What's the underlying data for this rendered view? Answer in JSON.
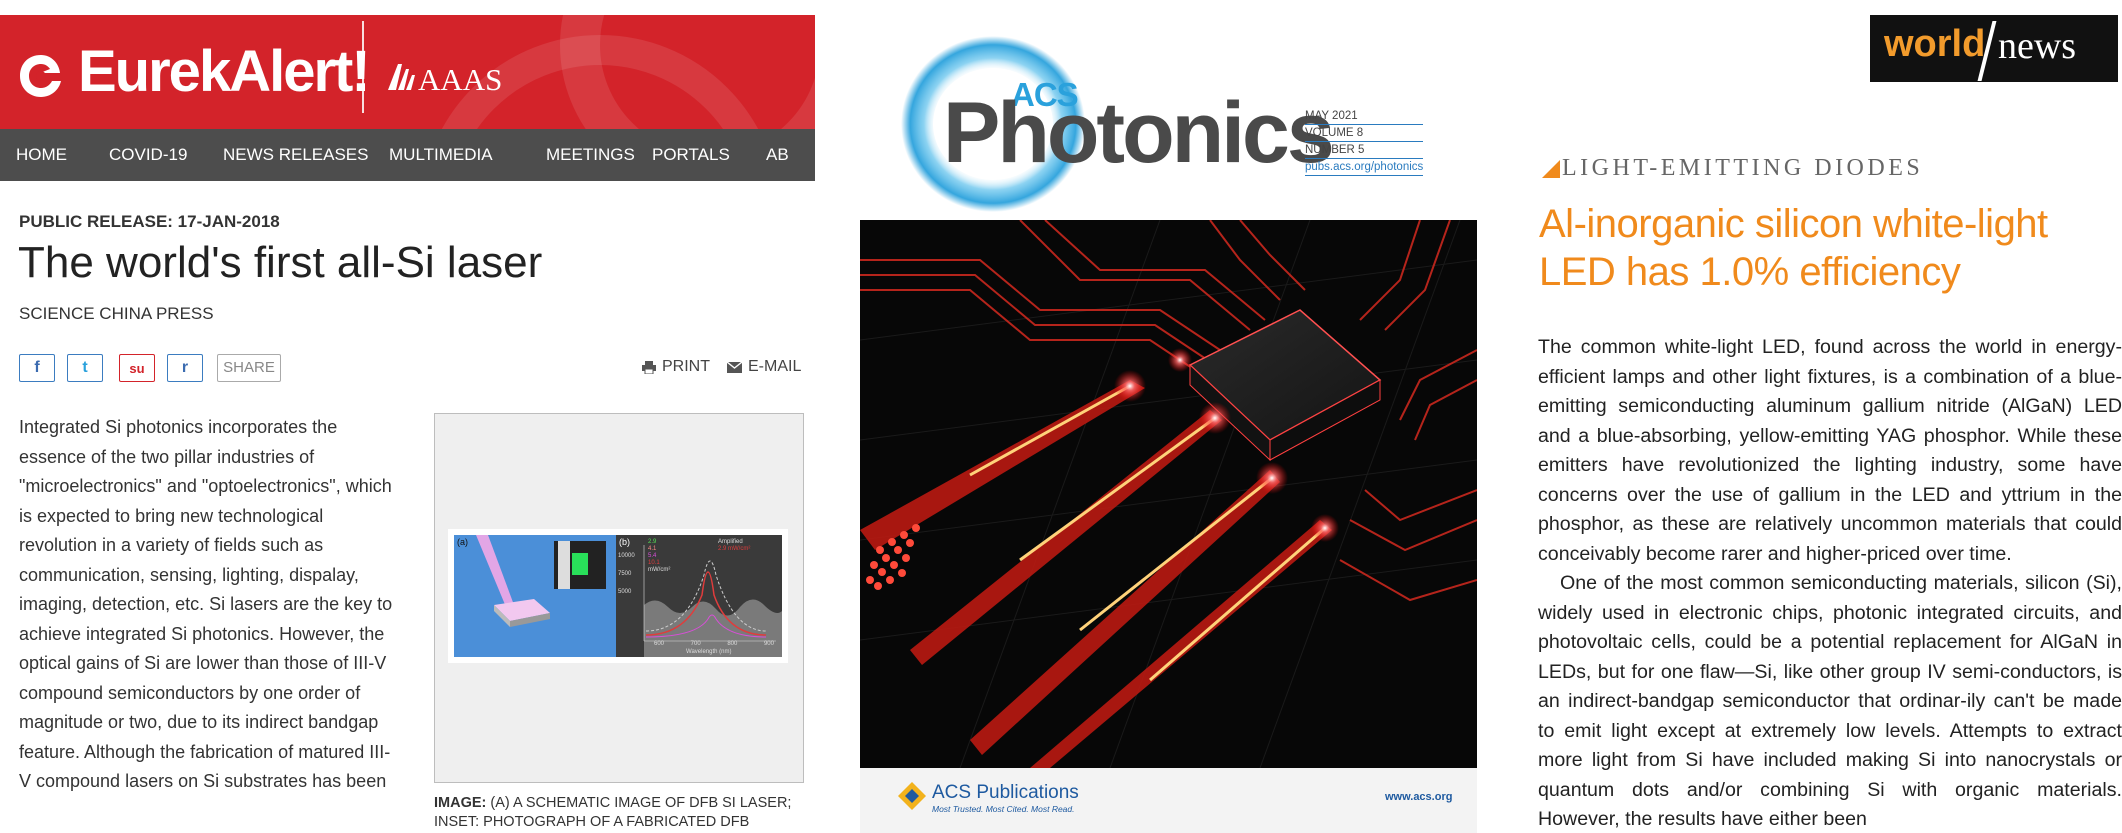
{
  "eurekalert": {
    "brand": "EurekAlert!",
    "partner": "AAAS",
    "nav": [
      "HOME",
      "COVID-19",
      "NEWS RELEASES",
      "MULTIMEDIA",
      "MEETINGS",
      "PORTALS",
      "AB"
    ],
    "release": "PUBLIC RELEASE: 17-JAN-2018",
    "title": "The world's first all-Si laser",
    "source": "SCIENCE CHINA PRESS",
    "share": {
      "facebook_glyph": "f",
      "twitter_glyph": "t",
      "stumble_glyph": "su",
      "reddit_glyph": "r",
      "label": "SHARE",
      "print": "PRINT",
      "email": "E-MAIL"
    },
    "body": "Integrated Si photonics incorporates the essence of the two pillar industries of \"microelectronics\" and \"optoelectronics\", which is expected to bring new technological revolution in a variety of fields such as communication, sensing, lighting, dispalay, imaging, detection, etc. Si lasers are the key to achieve integrated Si photonics. However, the optical gains of Si are lower than those of III-V compound semiconductors by one order of magnitude or two, due to its indirect bandgap feature. Although the fabrication of matured III-V compound lasers on Si substrates has been",
    "figure": {
      "panel_a": "(a)",
      "panel_b": "(b)",
      "legend": [
        "2.9",
        "4.1",
        "5.4",
        "10.1"
      ],
      "legend_unit": "mW/cm²",
      "legend_right": [
        "Amplified",
        "2.9 mW/cm²"
      ],
      "y_ticks": [
        "10000",
        "7500",
        "5000"
      ],
      "x_ticks": [
        "600",
        "700",
        "800",
        "900"
      ],
      "x_label": "Wavelength (nm)"
    },
    "caption_label": "IMAGE:",
    "caption_text": " (A) A SCHEMATIC IMAGE OF DFB SI LASER; INSET: PHOTOGRAPH OF A FABRICATED DFB"
  },
  "acs": {
    "small": "ACS",
    "title": "Photonics",
    "meta": [
      "MAY 2021",
      "VOLUME 8",
      "NUMBER 5",
      "pubs.acs.org/photonics"
    ],
    "publisher": "ACS Publications",
    "tagline": "Most Trusted. Most Cited. Most Read.",
    "www": "www.acs.org"
  },
  "worldnews": {
    "logo_world": "world",
    "logo_news": "news",
    "kicker": "LIGHT-EMITTING DIODES",
    "headline": "Al-inorganic silicon white-light LED has 1.0% efficiency",
    "para1": "The common white-light LED, found across the world in energy-efficient lamps and other light fixtures, is a combination of a blue-emitting semiconducting aluminum gallium nitride (AlGaN) LED and a blue-absorbing, yellow-emitting YAG phosphor. While these emitters have revolutionized the lighting industry, some have concerns over the use of gallium in the LED and yttrium in the phosphor, as these are relatively uncommon materials that could conceivably become rarer and higher-priced over time.",
    "para2": "One of the most common semiconducting materials, silicon (Si), widely used in electronic chips, photonic integrated circuits, and photovoltaic cells, could be a potential replacement for AlGaN in LEDs, but for one flaw—Si, like other group IV semi-conductors, is an indirect-bandgap semiconductor that ordinar-ily can't be made to emit light except at extremely low levels. Attempts to extract more light from Si have included making Si into nanocrystals or quantum dots and/or combining Si with organic materials. However, the results have either been"
  },
  "colors": {
    "eurekalert_red": "#d3232a",
    "nav_gray": "#4d4d4d",
    "acs_blue": "#2aa1dc",
    "worldnews_orange": "#f08a1c"
  }
}
